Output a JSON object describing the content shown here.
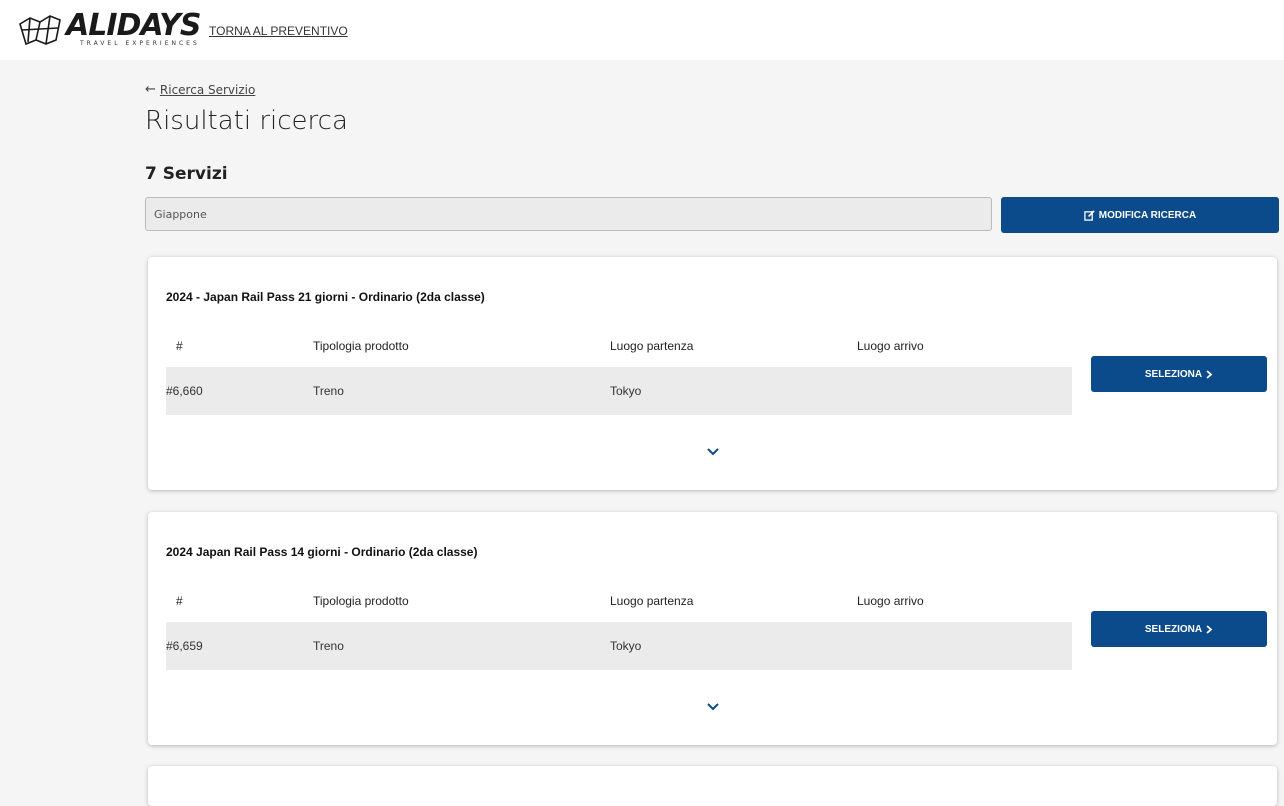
{
  "header": {
    "logo_word": "ALIDAYS",
    "logo_sub": "TRAVEL EXPERIENCES",
    "back_to_quote": "TORNA AL PREVENTIVO"
  },
  "breadcrumb": {
    "arrow": "←",
    "link": "Ricerca Servizio"
  },
  "page_title": "Risultati ricerca",
  "results_count": {
    "number": "7",
    "label": "Servizi"
  },
  "search": {
    "value": "Giappone"
  },
  "modify_button": {
    "label": "MODIFICA RICERCA",
    "icon": "edit-icon"
  },
  "columns": [
    "#",
    "Tipologia prodotto",
    "Luogo partenza",
    "Luogo arrivo"
  ],
  "results": [
    {
      "title": "2024 - Japan Rail Pass 21 giorni - Ordinario (2da classe)",
      "id": "#6,660",
      "type": "Treno",
      "departure": "Tokyo",
      "arrival": "",
      "select_label": "SELEZIONA"
    },
    {
      "title": "2024 Japan Rail Pass 14 giorni - Ordinario (2da classe)",
      "id": "#6,659",
      "type": "Treno",
      "departure": "Tokyo",
      "arrival": "",
      "select_label": "SELEZIONA"
    }
  ],
  "colors": {
    "primary": "#0b4a8b",
    "row_bg": "#ebebeb",
    "page_bg": "#f5f5f5"
  }
}
